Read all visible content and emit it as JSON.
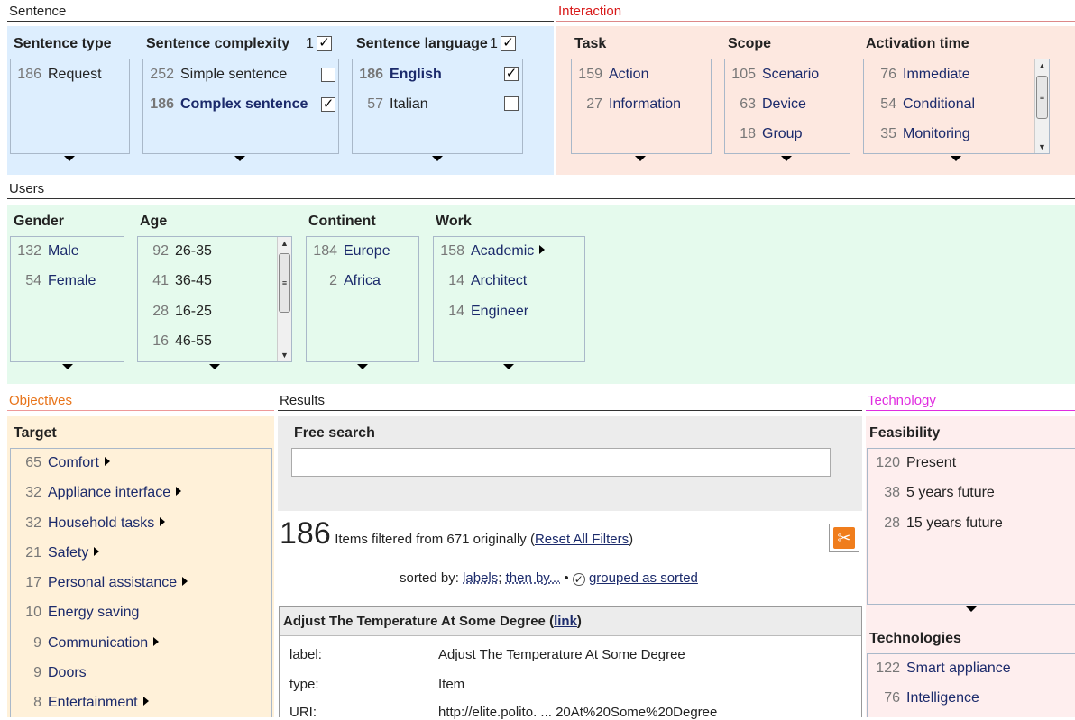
{
  "sentence": {
    "title": "Sentence",
    "type": {
      "title": "Sentence type",
      "items": [
        {
          "count": "186",
          "label": "Request"
        }
      ]
    },
    "complexity": {
      "title": "Sentence complexity",
      "num": "1",
      "items": [
        {
          "count": "252",
          "label": "Simple sentence",
          "checked": ""
        },
        {
          "count": "186",
          "label": "Complex sentence",
          "checked": "✓"
        }
      ]
    },
    "language": {
      "title": "Sentence language",
      "num": "1",
      "items": [
        {
          "count": "186",
          "label": "English",
          "checked": "✓"
        },
        {
          "count": "57",
          "label": "Italian",
          "checked": ""
        }
      ]
    }
  },
  "interaction": {
    "title": "Interaction",
    "task": {
      "title": "Task",
      "items": [
        {
          "count": "159",
          "label": "Action"
        },
        {
          "count": "27",
          "label": "Information"
        }
      ]
    },
    "scope": {
      "title": "Scope",
      "items": [
        {
          "count": "105",
          "label": "Scenario"
        },
        {
          "count": "63",
          "label": "Device"
        },
        {
          "count": "18",
          "label": "Group"
        }
      ]
    },
    "activation": {
      "title": "Activation time",
      "items": [
        {
          "count": "76",
          "label": "Immediate"
        },
        {
          "count": "54",
          "label": "Conditional"
        },
        {
          "count": "35",
          "label": "Monitoring"
        }
      ]
    }
  },
  "users": {
    "title": "Users",
    "gender": {
      "title": "Gender",
      "items": [
        {
          "count": "132",
          "label": "Male"
        },
        {
          "count": "54",
          "label": "Female"
        }
      ]
    },
    "age": {
      "title": "Age",
      "items": [
        {
          "count": "92",
          "label": "26-35"
        },
        {
          "count": "41",
          "label": "36-45"
        },
        {
          "count": "28",
          "label": "16-25"
        },
        {
          "count": "16",
          "label": "46-55"
        }
      ]
    },
    "continent": {
      "title": "Continent",
      "items": [
        {
          "count": "184",
          "label": "Europe"
        },
        {
          "count": "2",
          "label": "Africa"
        }
      ]
    },
    "work": {
      "title": "Work",
      "items": [
        {
          "count": "158",
          "label": "Academic"
        },
        {
          "count": "14",
          "label": "Architect"
        },
        {
          "count": "14",
          "label": "Engineer"
        }
      ]
    }
  },
  "objectives": {
    "title": "Objectives",
    "target": {
      "title": "Target",
      "items": [
        {
          "count": "65",
          "label": "Comfort"
        },
        {
          "count": "32",
          "label": "Appliance interface"
        },
        {
          "count": "32",
          "label": "Household tasks"
        },
        {
          "count": "21",
          "label": "Safety"
        },
        {
          "count": "17",
          "label": "Personal assistance"
        },
        {
          "count": "10",
          "label": "Energy saving"
        },
        {
          "count": "9",
          "label": "Communication"
        },
        {
          "count": "9",
          "label": "Doors"
        },
        {
          "count": "8",
          "label": "Entertainment"
        }
      ]
    }
  },
  "results": {
    "title": "Results",
    "search_title": "Free search",
    "search_value": "",
    "count": "186",
    "filtered_text": "Items filtered from 671 originally (",
    "reset": "Reset All Filters",
    "close_paren": ")",
    "sorted_by": "sorted by:",
    "sort_labels": "labels",
    "sort_semicolon": ";",
    "then_by": "then by...",
    "bullet": "•",
    "grouped_check": "✓",
    "grouped": "grouped as sorted",
    "item": {
      "title": "Adjust The Temperature At Some Degree",
      "link_open": "(",
      "link": "link",
      "link_close": ")",
      "props": [
        {
          "key": "label:",
          "value": "Adjust The Temperature At Some Degree"
        },
        {
          "key": "type:",
          "value": "Item"
        },
        {
          "key": "URI:",
          "value": "http://elite.polito. ... 20At%20Some%20Degree"
        }
      ]
    }
  },
  "technology": {
    "title": "Technology",
    "feasibility": {
      "title": "Feasibility",
      "items": [
        {
          "count": "120",
          "label": "Present"
        },
        {
          "count": "38",
          "label": "5 years future"
        },
        {
          "count": "28",
          "label": "15 years future"
        }
      ]
    },
    "technologies": {
      "title": "Technologies",
      "items": [
        {
          "count": "122",
          "label": "Smart appliance"
        },
        {
          "count": "76",
          "label": "Intelligence"
        }
      ]
    }
  },
  "colors": {
    "sentence": "#ddeefe",
    "interaction": "#fde8e0",
    "users": "#e5faed",
    "objectives": "#fff1d9",
    "technology": "#feeeee",
    "interaction_title": "#d81818",
    "objectives_title": "#e8741a",
    "technology_title": "#e02de0"
  }
}
